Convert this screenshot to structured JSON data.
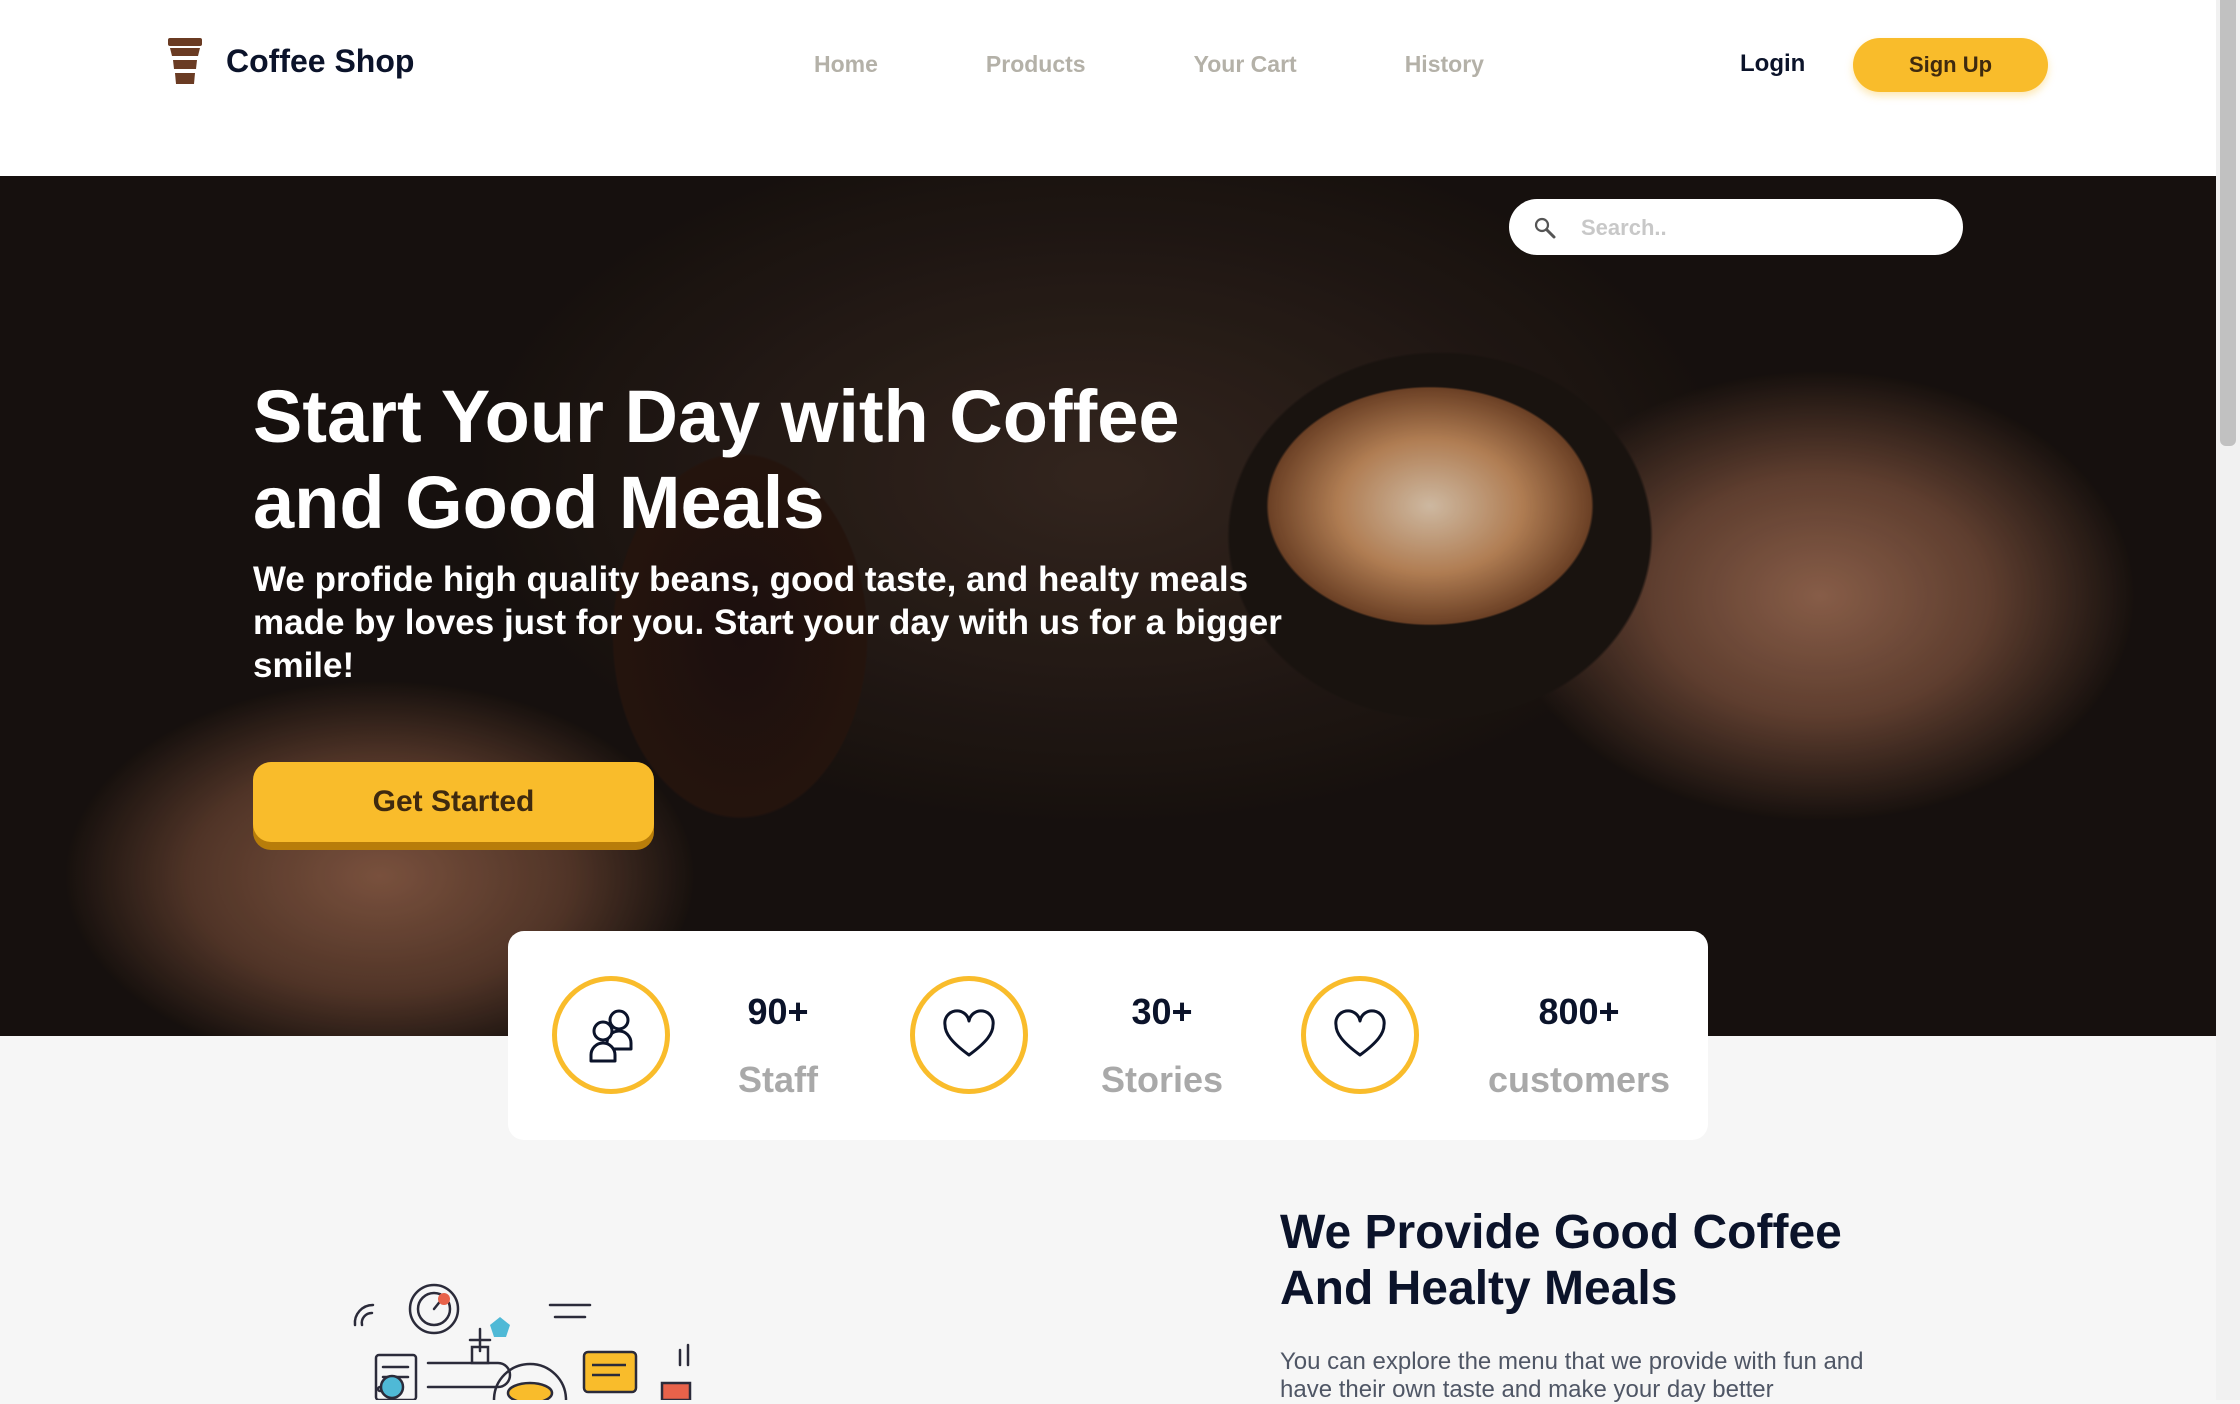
{
  "brand": {
    "name": "Coffee Shop",
    "logo_icon": "coffee-cup-icon"
  },
  "nav": {
    "links": [
      "Home",
      "Products",
      "Your Cart",
      "History"
    ]
  },
  "auth": {
    "login_label": "Login",
    "signup_label": "Sign Up"
  },
  "search": {
    "placeholder": "Search..",
    "icon": "search-icon"
  },
  "hero": {
    "title": "Start Your Day with Coffee and Good Meals",
    "subtitle": "We profide high quality beans, good taste, and healty meals made by loves just for you. Start your day with us for a bigger smile!",
    "cta_label": "Get Started"
  },
  "stats": [
    {
      "icon": "users-icon",
      "value": "90+",
      "label": "Staff"
    },
    {
      "icon": "heart-icon",
      "value": "30+",
      "label": "Stories"
    },
    {
      "icon": "heart-icon",
      "value": "800+",
      "label": "customers"
    }
  ],
  "about": {
    "title": "We Provide Good Coffee And Healty Meals",
    "text": "You can explore the menu that we provide with fun and have their own taste and make your day better"
  },
  "colors": {
    "accent": "#f9bc2b",
    "text_dark": "#0b132a",
    "nav_muted": "#b4b1a8",
    "stat_label": "#a9a9a9"
  }
}
